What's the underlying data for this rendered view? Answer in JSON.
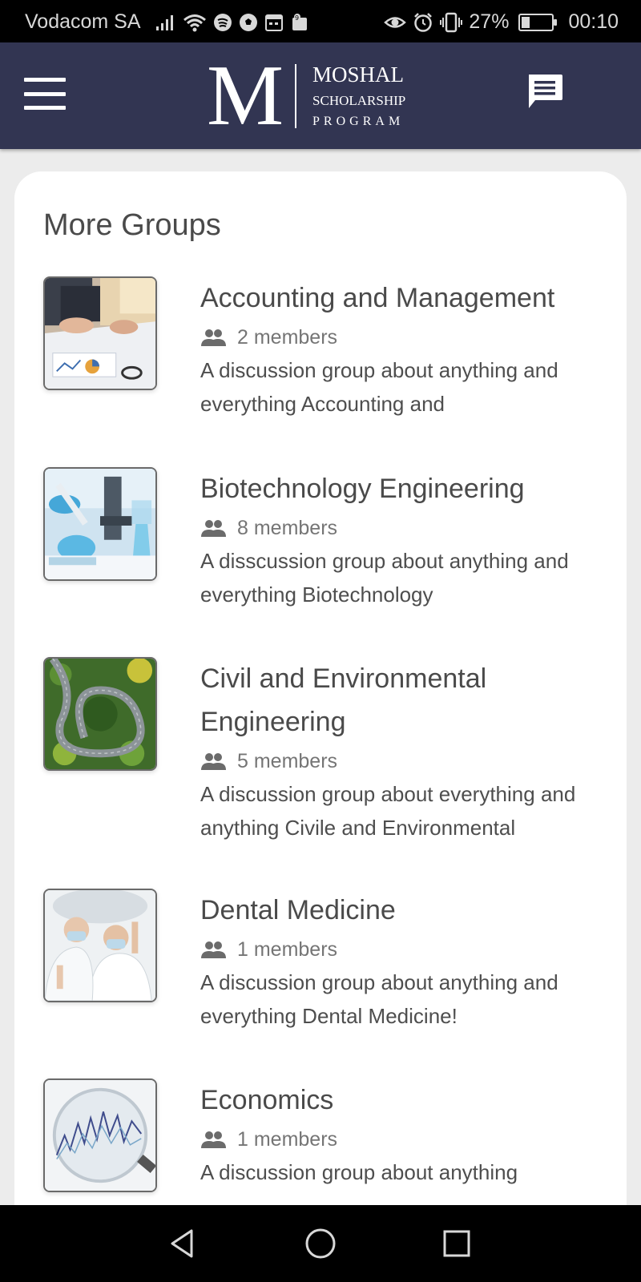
{
  "status_bar": {
    "carrier": "Vodacom SA",
    "battery_percent": "27%",
    "battery_level": 0.27,
    "time": "00:10"
  },
  "header": {
    "logo_letter": "M",
    "logo_line1": "MOSHAL",
    "logo_line2": "SCHOLARSHIP",
    "logo_line3": "PROGRAM",
    "brand_color": "#323552"
  },
  "section": {
    "title": "More Groups"
  },
  "groups": [
    {
      "name": "Accounting and Management",
      "members": "2 members",
      "description": "A discussion group about anything and everything Accounting and",
      "image": "business-meeting-image"
    },
    {
      "name": "Biotechnology Engineering",
      "members": "8 members",
      "description": "A disscussion group about anything and everything Biotechnology",
      "image": "lab-pipette-image"
    },
    {
      "name": "Civil and Environmental Engineering",
      "members": "5 members",
      "description": "A discussion group about everything and anything Civile and Environmental",
      "image": "forest-road-image"
    },
    {
      "name": "Dental Medicine",
      "members": "1 members",
      "description": "A discussion group about anything and everything Dental Medicine!",
      "image": "dentists-image"
    },
    {
      "name": "Economics",
      "members": "1 members",
      "description": "A discussion group about anything",
      "image": "magnifier-chart-image"
    }
  ]
}
